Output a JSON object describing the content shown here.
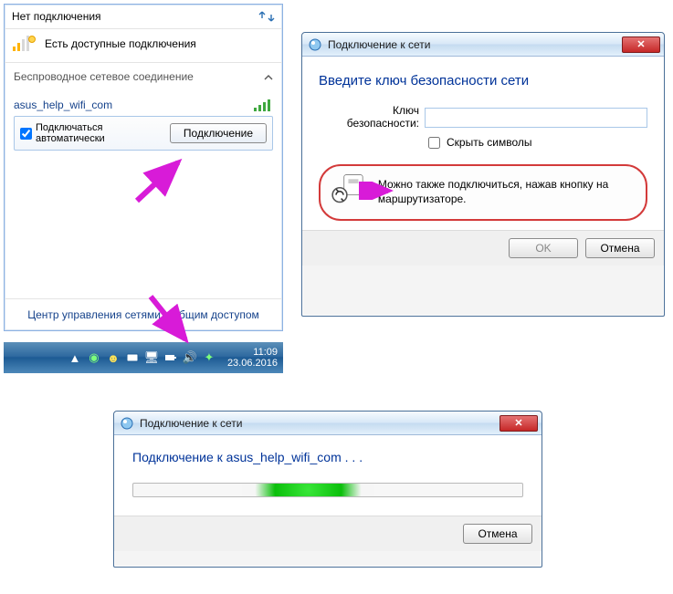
{
  "flyout": {
    "title": "Нет подключения",
    "available": "Есть доступные подключения",
    "section": "Беспроводное сетевое соединение",
    "network_name": "asus_help_wifi_com",
    "auto_connect": "Подключаться автоматически",
    "auto_connect_checked": true,
    "connect_btn": "Подключение",
    "footer_link": "Центр управления сетями и общим доступом"
  },
  "taskbar": {
    "time": "11:09",
    "date": "23.06.2016"
  },
  "dlg_sec": {
    "title": "Подключение к сети",
    "heading": "Введите ключ безопасности сети",
    "key_label": "Ключ безопасности:",
    "hide_chars": "Скрыть символы",
    "wps_text": "Можно также подключиться, нажав кнопку на маршрутизаторе.",
    "ok": "OK",
    "cancel": "Отмена"
  },
  "dlg_conn": {
    "title": "Подключение к сети",
    "connecting_to": "Подключение к asus_help_wifi_com . . .",
    "cancel": "Отмена"
  }
}
